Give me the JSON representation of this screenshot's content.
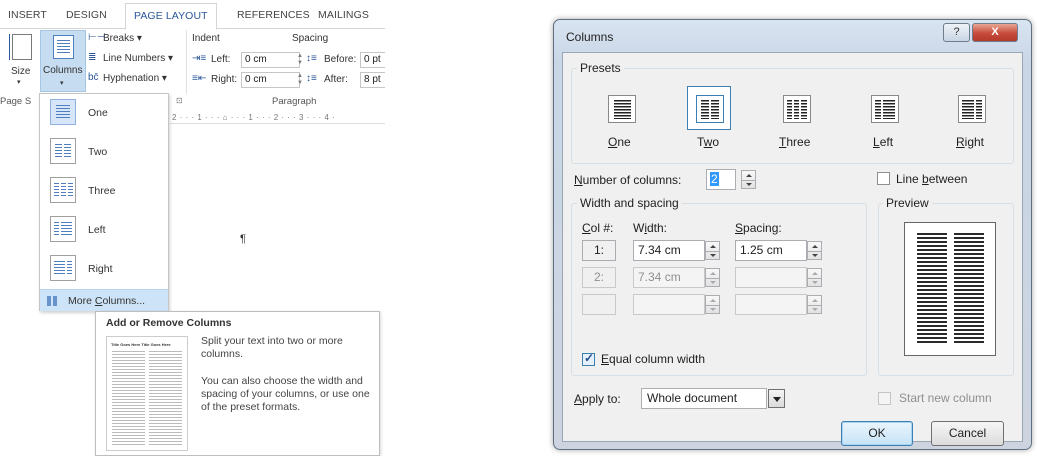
{
  "ribbon": {
    "tabs": [
      "INSERT",
      "DESIGN",
      "PAGE LAYOUT",
      "REFERENCES",
      "MAILINGS"
    ],
    "active_tab": "PAGE LAYOUT",
    "size_label": "Size",
    "columns_label": "Columns",
    "breaks_label": "Breaks ▾",
    "line_numbers_label": "Line Numbers ▾",
    "hyphenation_label": "Hyphenation ▾",
    "indent_header": "Indent",
    "spacing_header": "Spacing",
    "indent_left_label": "Left:",
    "indent_left_value": "0 cm",
    "indent_right_label": "Right:",
    "indent_right_value": "0 cm",
    "spacing_before_label": "Before:",
    "spacing_before_value": "0 pt",
    "spacing_after_label": "After:",
    "spacing_after_value": "8 pt",
    "group_page_setup": "Page S",
    "group_paragraph": "Paragraph"
  },
  "ruler": {
    "text": "2 · · · 1 · · · ⌂ · · · 1 · · · 2 · · · 3 · · · 4 ·"
  },
  "document": {
    "pilcrow": "¶"
  },
  "columns_menu": {
    "items": [
      {
        "label": "One"
      },
      {
        "label": "Two"
      },
      {
        "label": "Three"
      },
      {
        "label": "Left"
      },
      {
        "label": "Right"
      }
    ],
    "more_prefix": "More ",
    "more_underlined": "C",
    "more_suffix": "olumns..."
  },
  "tooltip": {
    "title": "Add or Remove Columns",
    "thumb_heading": "Title Goes Here Title Goes Here",
    "line1": "Split your text into two or more columns.",
    "line2": "You can also choose the width and spacing of your columns, or use one of the preset formats."
  },
  "dialog": {
    "title": "Columns",
    "help_button": "?",
    "close_button": "X",
    "presets_label": "Presets",
    "presets": [
      {
        "key": "O",
        "rest": "ne"
      },
      {
        "key": "",
        "pre": "T",
        "ukey": "w",
        "rest": "o"
      },
      {
        "key": "T",
        "rest": "hree"
      },
      {
        "key": "L",
        "rest": "eft"
      },
      {
        "key": "R",
        "rest": "ight"
      }
    ],
    "num_columns_key": "N",
    "num_columns_rest": "umber of columns:",
    "num_columns_value": "2",
    "line_between_pre": "Line ",
    "line_between_key": "b",
    "line_between_rest": "etween",
    "line_between_checked": false,
    "width_spacing_label": "Width and spacing",
    "col_header_key": "C",
    "col_header_rest": "ol #:",
    "width_header_pre": "W",
    "width_header_key": "i",
    "width_header_rest": "dth:",
    "spacing_header_key": "S",
    "spacing_header_rest": "pacing:",
    "rows": [
      {
        "num": "1:",
        "width": "7.34 cm",
        "spacing": "1.25 cm",
        "enabled": true
      },
      {
        "num": "2:",
        "width": "7.34 cm",
        "spacing": "",
        "enabled": false
      },
      {
        "num": "",
        "width": "",
        "spacing": "",
        "enabled": false
      }
    ],
    "equal_width_key": "E",
    "equal_width_rest": "qual column width",
    "equal_width_checked": true,
    "preview_label": "Preview",
    "apply_to_key": "A",
    "apply_to_rest": "pply to:",
    "apply_to_value": "Whole document",
    "start_new_column_label": "Start new column",
    "start_new_column_checked": false,
    "ok_label": "OK",
    "cancel_label": "Cancel"
  },
  "colors": {
    "accent": "#2b579a",
    "selection": "#c5dcf1",
    "close_button": "#c74a3a"
  }
}
